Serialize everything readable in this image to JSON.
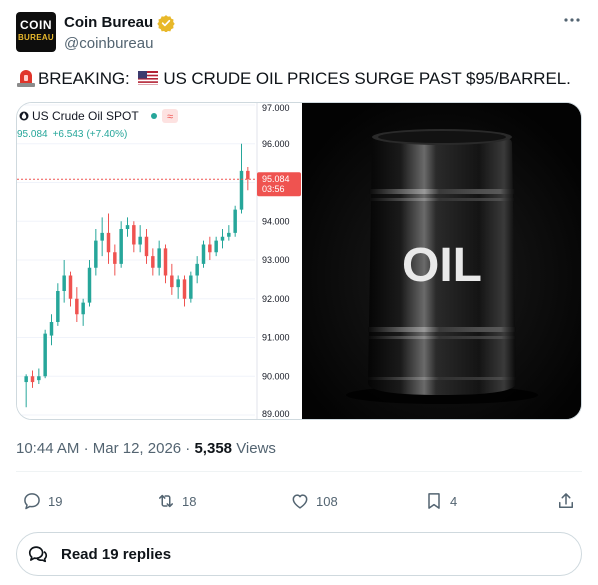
{
  "author": {
    "avatar_line1": "COIN",
    "avatar_line2": "BUREAU",
    "display_name": "Coin Bureau",
    "handle": "@coinbureau"
  },
  "post": {
    "text_before": "BREAKING: ",
    "text_after": "US CRUDE OIL PRICES SURGE PAST $95/BARREL."
  },
  "chart_data": {
    "type": "candlestick",
    "title": "US Crude Oil SPOT",
    "price": "95.084",
    "change": "+6.543",
    "change_pct": "(+7.40%)",
    "last_price_tag": "95.084",
    "countdown": "03:56",
    "ylim": [
      89.0,
      97.0
    ],
    "y_ticks": [
      "97.000",
      "96.000",
      "95.000",
      "94.000",
      "93.000",
      "92.000",
      "91.000",
      "90.000",
      "89.000"
    ],
    "up_color": "#26a69a",
    "down_color": "#ef5350",
    "candles": [
      {
        "o": 89.85,
        "h": 90.05,
        "l": 89.2,
        "c": 90.0
      },
      {
        "o": 90.0,
        "h": 90.15,
        "l": 89.7,
        "c": 89.85
      },
      {
        "o": 89.9,
        "h": 90.2,
        "l": 89.8,
        "c": 90.0
      },
      {
        "o": 90.0,
        "h": 91.2,
        "l": 89.95,
        "c": 91.1
      },
      {
        "o": 91.05,
        "h": 91.6,
        "l": 90.8,
        "c": 91.4
      },
      {
        "o": 91.4,
        "h": 92.4,
        "l": 91.3,
        "c": 92.2
      },
      {
        "o": 92.2,
        "h": 93.0,
        "l": 91.9,
        "c": 92.6
      },
      {
        "o": 92.6,
        "h": 92.7,
        "l": 91.8,
        "c": 92.0
      },
      {
        "o": 92.0,
        "h": 92.3,
        "l": 91.4,
        "c": 91.6
      },
      {
        "o": 91.6,
        "h": 92.0,
        "l": 91.3,
        "c": 91.9
      },
      {
        "o": 91.9,
        "h": 93.0,
        "l": 91.8,
        "c": 92.8
      },
      {
        "o": 92.8,
        "h": 93.8,
        "l": 92.6,
        "c": 93.5
      },
      {
        "o": 93.5,
        "h": 94.1,
        "l": 93.1,
        "c": 93.7
      },
      {
        "o": 93.7,
        "h": 94.2,
        "l": 92.9,
        "c": 93.2
      },
      {
        "o": 93.2,
        "h": 93.4,
        "l": 92.6,
        "c": 92.9
      },
      {
        "o": 92.9,
        "h": 94.0,
        "l": 92.8,
        "c": 93.8
      },
      {
        "o": 93.8,
        "h": 94.1,
        "l": 93.6,
        "c": 93.9
      },
      {
        "o": 93.9,
        "h": 94.0,
        "l": 93.2,
        "c": 93.4
      },
      {
        "o": 93.4,
        "h": 93.9,
        "l": 93.2,
        "c": 93.6
      },
      {
        "o": 93.6,
        "h": 93.8,
        "l": 92.9,
        "c": 93.1
      },
      {
        "o": 93.1,
        "h": 93.3,
        "l": 92.6,
        "c": 92.8
      },
      {
        "o": 92.8,
        "h": 93.5,
        "l": 92.6,
        "c": 93.3
      },
      {
        "o": 93.3,
        "h": 93.4,
        "l": 92.4,
        "c": 92.6
      },
      {
        "o": 92.6,
        "h": 92.9,
        "l": 92.1,
        "c": 92.3
      },
      {
        "o": 92.3,
        "h": 92.6,
        "l": 92.0,
        "c": 92.5
      },
      {
        "o": 92.5,
        "h": 92.6,
        "l": 91.8,
        "c": 92.0
      },
      {
        "o": 92.0,
        "h": 92.7,
        "l": 91.9,
        "c": 92.6
      },
      {
        "o": 92.6,
        "h": 93.1,
        "l": 92.4,
        "c": 92.9
      },
      {
        "o": 92.9,
        "h": 93.5,
        "l": 92.8,
        "c": 93.4
      },
      {
        "o": 93.4,
        "h": 93.6,
        "l": 93.0,
        "c": 93.2
      },
      {
        "o": 93.2,
        "h": 93.6,
        "l": 93.1,
        "c": 93.5
      },
      {
        "o": 93.5,
        "h": 93.8,
        "l": 93.3,
        "c": 93.6
      },
      {
        "o": 93.6,
        "h": 93.9,
        "l": 93.5,
        "c": 93.7
      },
      {
        "o": 93.7,
        "h": 94.4,
        "l": 93.6,
        "c": 94.3
      },
      {
        "o": 94.3,
        "h": 96.0,
        "l": 94.2,
        "c": 95.3
      },
      {
        "o": 95.3,
        "h": 95.4,
        "l": 94.8,
        "c": 95.084
      }
    ]
  },
  "barrel": {
    "label": "OIL"
  },
  "meta": {
    "time": "10:44 AM",
    "dot1": "·",
    "date": "Mar 12, 2026",
    "dot2": "·",
    "views_count": "5,358",
    "views_label": "Views"
  },
  "actions": {
    "replies": "19",
    "reposts": "18",
    "likes": "108",
    "bookmarks": "4"
  },
  "read_replies_label": "Read 19 replies",
  "colors": {
    "verified_gold": "#e8b829",
    "barrel_black": "#0a0a0a"
  }
}
